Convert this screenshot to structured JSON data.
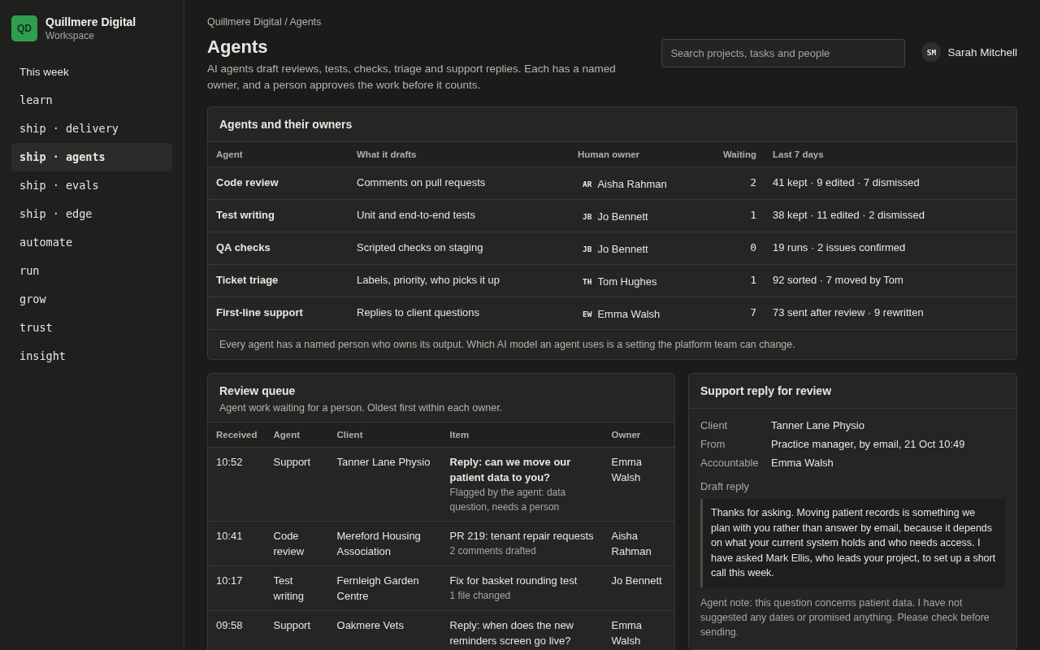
{
  "brand": {
    "initials": "QD",
    "name": "Quillmere Digital",
    "subtitle": "Workspace"
  },
  "sidebar": {
    "items": [
      {
        "label": "This week",
        "kind": "overview",
        "selected": false
      },
      {
        "label": "learn",
        "kind": "section",
        "selected": false
      },
      {
        "label": "ship · delivery",
        "kind": "section",
        "selected": false
      },
      {
        "label": "ship · agents",
        "kind": "section",
        "selected": true
      },
      {
        "label": "ship · evals",
        "kind": "section",
        "selected": false
      },
      {
        "label": "ship · edge",
        "kind": "section",
        "selected": false
      },
      {
        "label": "automate",
        "kind": "section",
        "selected": false
      },
      {
        "label": "run",
        "kind": "section",
        "selected": false
      },
      {
        "label": "grow",
        "kind": "section",
        "selected": false
      },
      {
        "label": "trust",
        "kind": "section",
        "selected": false
      },
      {
        "label": "insight",
        "kind": "section",
        "selected": false
      }
    ]
  },
  "header": {
    "breadcrumb": "Quillmere Digital / Agents",
    "title": "Agents",
    "description": "AI agents draft reviews, tests, checks, triage and support replies. Each has a named owner, and a person approves the work before it counts.",
    "search": {
      "placeholder": "Search projects, tasks and people"
    },
    "user": {
      "initials": "SM",
      "name": "Sarah Mitchell"
    }
  },
  "agents_table": {
    "title": "Agents and their owners",
    "columns": [
      "Agent",
      "What it drafts",
      "Human owner",
      "Waiting",
      "Last 7 days"
    ],
    "rows": [
      {
        "agent": "Code review",
        "drafts": "Comments on pull requests",
        "owner_initials": "AR",
        "owner": "Aisha Rahman",
        "waiting": "2",
        "last_7_days": "41 kept · 9 edited · 7 dismissed"
      },
      {
        "agent": "Test writing",
        "drafts": "Unit and end-to-end tests",
        "owner_initials": "JB",
        "owner": "Jo Bennett",
        "waiting": "1",
        "last_7_days": "38 kept · 11 edited · 2 dismissed"
      },
      {
        "agent": "QA checks",
        "drafts": "Scripted checks on staging",
        "owner_initials": "JB",
        "owner": "Jo Bennett",
        "waiting": "0",
        "last_7_days": "19 runs · 2 issues confirmed"
      },
      {
        "agent": "Ticket triage",
        "drafts": "Labels, priority, who picks it up",
        "owner_initials": "TH",
        "owner": "Tom Hughes",
        "waiting": "1",
        "last_7_days": "92 sorted · 7 moved by Tom"
      },
      {
        "agent": "First-line support",
        "drafts": "Replies to client questions",
        "owner_initials": "EW",
        "owner": "Emma Walsh",
        "waiting": "7",
        "last_7_days": "73 sent after review · 9 rewritten"
      }
    ],
    "footnote": "Every agent has a named person who owns its output. Which AI model an agent uses is a setting the platform team can change."
  },
  "review_queue": {
    "title": "Review queue",
    "subtitle": "Agent work waiting for a person. Oldest first within each owner.",
    "columns": [
      "Received",
      "Agent",
      "Client",
      "Item",
      "Owner"
    ],
    "rows": [
      {
        "received": "10:52",
        "agent": "Support",
        "client": "Tanner Lane Physio",
        "item": "Reply: can we move our patient data to you?",
        "item_emphasis": true,
        "detail": "Flagged by the agent: data question, needs a person",
        "owner": "Emma Walsh"
      },
      {
        "received": "10:41",
        "agent": "Code review",
        "client": "Mereford Housing Association",
        "item": "PR 219: tenant repair requests",
        "item_emphasis": false,
        "detail": "2 comments drafted",
        "owner": "Aisha Rahman"
      },
      {
        "received": "10:17",
        "agent": "Test writing",
        "client": "Fernleigh Garden Centre",
        "item": "Fix for basket rounding test",
        "item_emphasis": false,
        "detail": "1 file changed",
        "owner": "Jo Bennett"
      },
      {
        "received": "09:58",
        "agent": "Support",
        "client": "Oakmere Vets",
        "item": "Reply: when does the new reminders screen go live?",
        "item_emphasis": false,
        "owner": "Emma Walsh"
      }
    ]
  },
  "support_reply": {
    "title": "Support reply for review",
    "fields": [
      {
        "label": "Client",
        "value": "Tanner Lane Physio"
      },
      {
        "label": "From",
        "value": "Practice manager, by email, 21 Oct 10:49"
      },
      {
        "label": "Accountable",
        "value": "Emma Walsh"
      }
    ],
    "draft_label": "Draft reply",
    "draft": "Thanks for asking. Moving patient records is something we plan with you rather than answer by email, because it depends on what your current system holds and who needs access. I have asked Mark Ellis, who leads your project, to set up a short call this week.",
    "agent_note": "Agent note: this question concerns patient data. I have not suggested any dates or promised anything. Please check before sending."
  }
}
